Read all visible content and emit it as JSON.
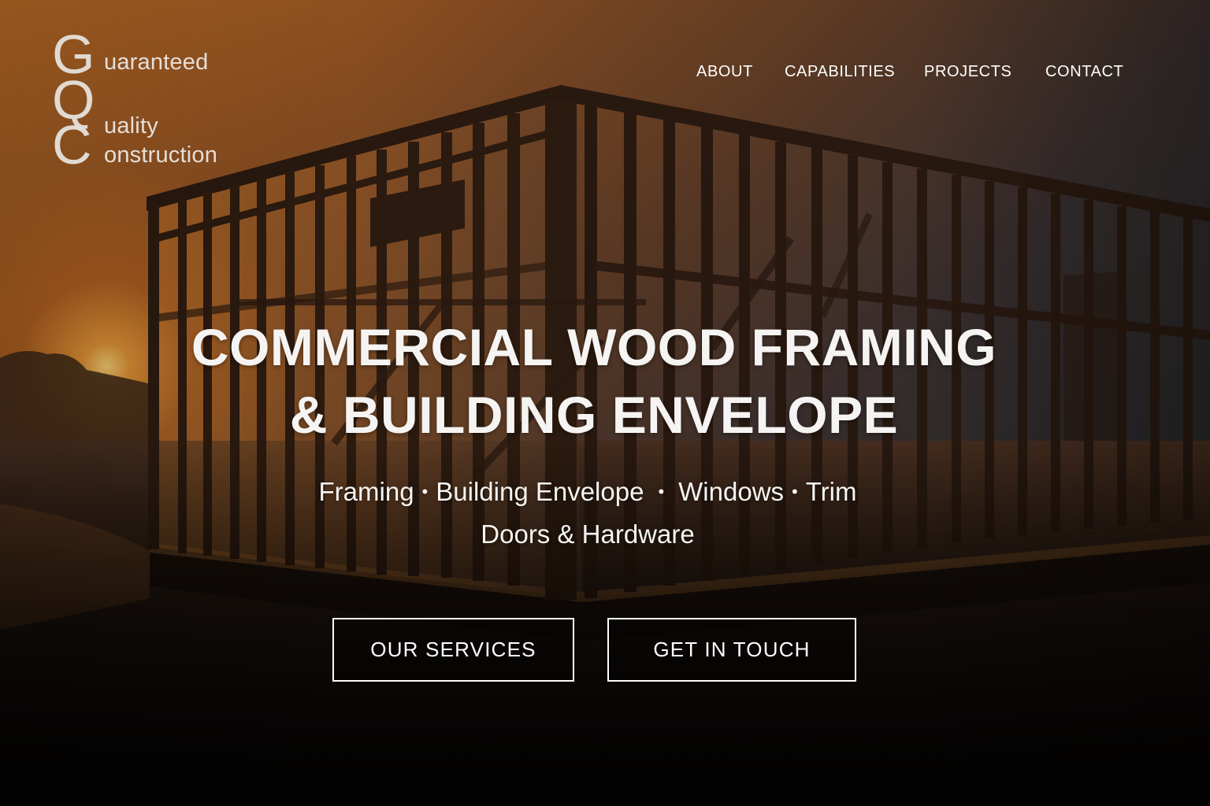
{
  "logo": {
    "initials": [
      "G",
      "Q",
      "C"
    ],
    "words": [
      "uaranteed",
      "uality",
      "onstruction"
    ]
  },
  "nav": {
    "items": [
      "ABOUT",
      "CAPABILITIES",
      "PROJECTS",
      "CONTACT"
    ]
  },
  "hero": {
    "headline_line1": "COMMERCIAL WOOD FRAMING",
    "headline_line2": "& BUILDING ENVELOPE",
    "services_row1": [
      "Framing",
      "Building Envelope",
      "Windows",
      "Trim"
    ],
    "services_separator": "•",
    "services_row2": "Doors & Hardware",
    "buttons": {
      "primary": "OUR SERVICES",
      "secondary": "GET IN TOUCH"
    }
  },
  "colors": {
    "sky_warm": "#b86a24",
    "sky_dark": "#262628",
    "text": "#f5f4f2",
    "frame_wood": "#3a2414"
  }
}
